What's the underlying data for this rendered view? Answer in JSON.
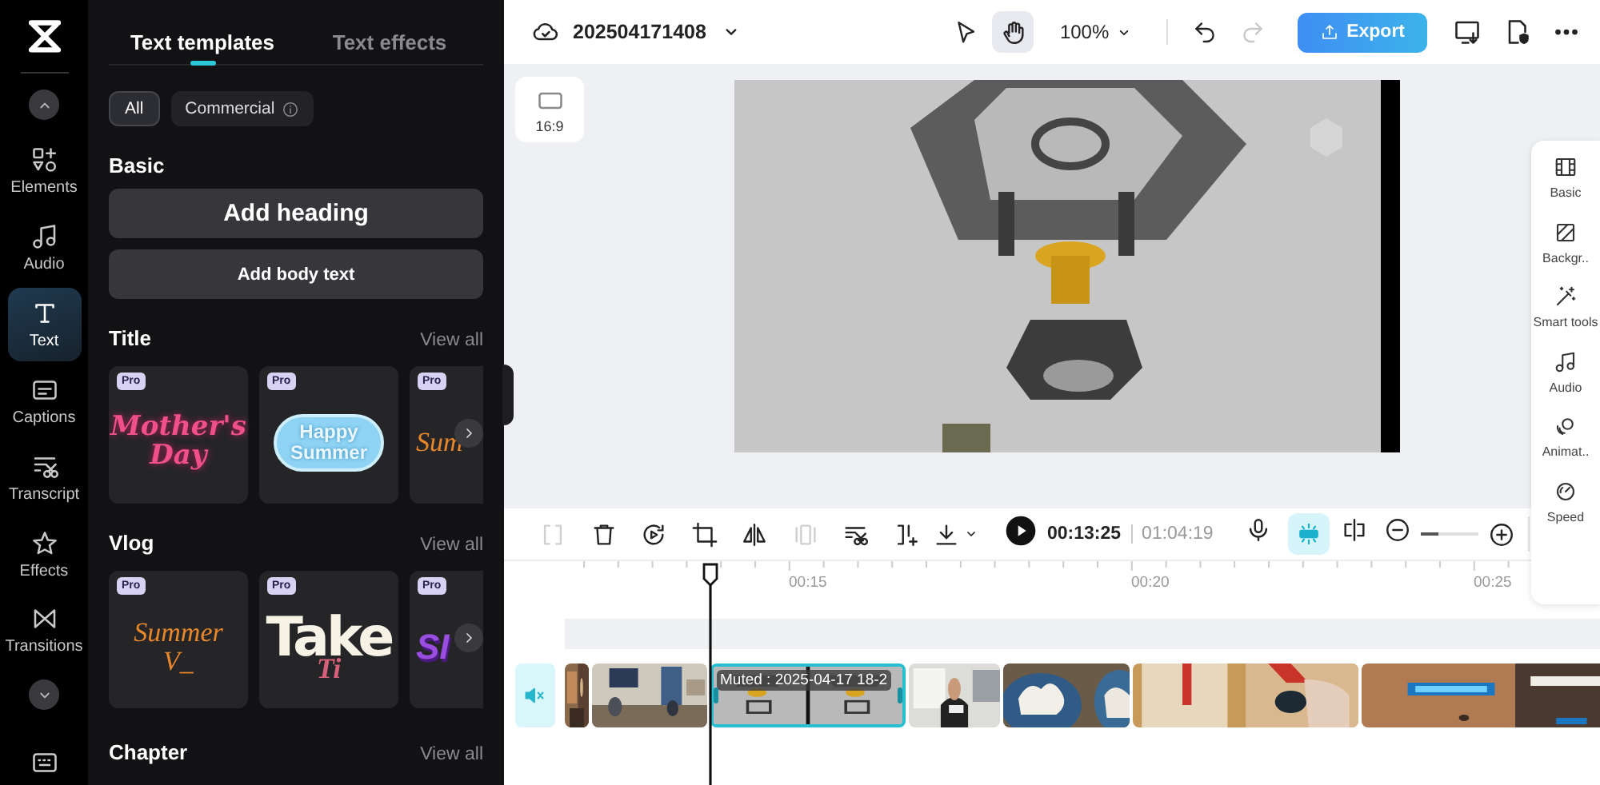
{
  "rail": {
    "items": [
      {
        "kind": "elements",
        "label": "Elements",
        "selected": false
      },
      {
        "kind": "audio",
        "label": "Audio",
        "selected": false
      },
      {
        "kind": "text",
        "label": "Text",
        "selected": true
      },
      {
        "kind": "captions",
        "label": "Captions",
        "selected": false
      },
      {
        "kind": "transcript",
        "label": "Transcript",
        "selected": false
      },
      {
        "kind": "effects",
        "label": "Effects",
        "selected": false
      },
      {
        "kind": "transitions",
        "label": "Transitions",
        "selected": false
      }
    ]
  },
  "panel": {
    "tabs": [
      {
        "label": "Text templates",
        "selected": true
      },
      {
        "label": "Text effects",
        "selected": false
      }
    ],
    "filters": [
      {
        "label": "All",
        "selected": true,
        "info": false
      },
      {
        "label": "Commercial",
        "selected": false,
        "info": true
      }
    ],
    "basic": {
      "title": "Basic",
      "buttons": [
        {
          "label": "Add heading",
          "kind": "heading"
        },
        {
          "label": "Add body text",
          "kind": "body"
        }
      ]
    },
    "sections": [
      {
        "title": "Title",
        "view_all": "View all",
        "cards": [
          {
            "badge": "Pro",
            "kind": "neon",
            "lines": [
              "Mother's",
              "Day"
            ]
          },
          {
            "badge": "Pro",
            "kind": "cloud",
            "lines": [
              "Happy",
              "Summer"
            ]
          },
          {
            "badge": "Pro",
            "kind": "serif",
            "lines": [
              "Sum"
            ]
          }
        ]
      },
      {
        "title": "Vlog",
        "view_all": "View all",
        "cards": [
          {
            "badge": "Pro",
            "kind": "serif",
            "lines": [
              "Summer",
              "V_"
            ]
          },
          {
            "badge": "Pro",
            "kind": "block",
            "lines": [
              "Take",
              "Ti"
            ]
          },
          {
            "badge": "Pro",
            "kind": "purple",
            "lines": [
              "SI"
            ]
          }
        ]
      },
      {
        "title": "Chapter",
        "view_all": "View all"
      }
    ]
  },
  "topbar": {
    "project": "202504171408",
    "pointer_tools": [
      {
        "kind": "select",
        "selected": false
      },
      {
        "kind": "hand",
        "selected": true
      }
    ],
    "zoom": "100%",
    "history": [
      {
        "kind": "undo",
        "disabled": false
      },
      {
        "kind": "redo",
        "disabled": true
      }
    ],
    "export": "Export"
  },
  "stage": {
    "aspect": "16:9",
    "preview": {
      "kind": "picture"
    }
  },
  "inspector": [
    {
      "kind": "basic",
      "label": "Basic"
    },
    {
      "kind": "background",
      "label": "Backgr.."
    },
    {
      "kind": "smart",
      "label": "Smart tools"
    },
    {
      "kind": "audio",
      "label": "Audio"
    },
    {
      "kind": "animation",
      "label": "Animat.."
    },
    {
      "kind": "speed",
      "label": "Speed"
    }
  ],
  "timeline": {
    "edit_tools": [
      {
        "kind": "split",
        "disabled": true
      },
      {
        "kind": "delete",
        "disabled": false
      },
      {
        "kind": "replace",
        "disabled": false
      },
      {
        "kind": "crop",
        "disabled": false
      },
      {
        "kind": "mirror",
        "disabled": false
      },
      {
        "kind": "freeze",
        "disabled": true
      },
      {
        "kind": "cut_audio",
        "disabled": false
      },
      {
        "kind": "trim",
        "disabled": false
      },
      {
        "kind": "download",
        "disabled": false
      }
    ],
    "current": "00:13:25",
    "total": "01:04:19",
    "magnet": {
      "on": true
    },
    "zoom": {
      "level": 0.3
    },
    "ticks": [
      "00:15",
      "00:20",
      "00:25"
    ],
    "track": {
      "muted": true
    },
    "clips": [
      {
        "kind": "picture",
        "selected": false
      },
      {
        "kind": "picture",
        "selected": false
      },
      {
        "kind": "picture",
        "selected": true,
        "label": "Muted : 2025-04-17 18-2"
      },
      {
        "kind": "picture",
        "selected": false
      },
      {
        "kind": "picture",
        "selected": false
      },
      {
        "kind": "picture",
        "selected": false
      },
      {
        "kind": "picture",
        "selected": false
      }
    ]
  }
}
